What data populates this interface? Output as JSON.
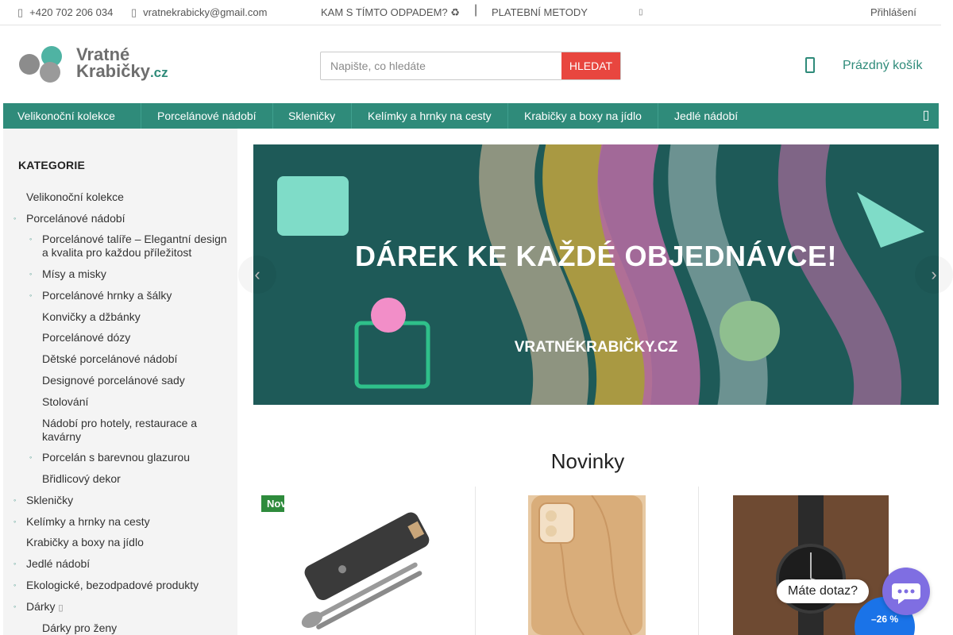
{
  "topbar": {
    "phone": "+420 702 206 034",
    "email": "vratnekrabicky@gmail.com",
    "link_waste": "KAM S TÍMTO ODPADEM? ♻",
    "separator": "|",
    "link_payment": "PLATEBNÍ METODY",
    "login": "Přihlášení"
  },
  "header": {
    "logo_line1": "Vratné",
    "logo_line2": "Krabičky",
    "logo_tld": ".cz",
    "search_placeholder": "Napište, co hledáte",
    "search_button": "HLEDAT",
    "cart_label": "Prázdný košík"
  },
  "nav": {
    "items": [
      "Velikonoční kolekce",
      "Porcelánové nádobí",
      "Skleničky",
      "Kelímky a hrnky na cesty",
      "Krabičky a boxy na jídlo",
      "Jedlé nádobí"
    ]
  },
  "sidebar": {
    "title": "KATEGORIE",
    "items": [
      "Velikonoční kolekce",
      "Porcelánové nádobí",
      "Porcelánové talíře – Elegantní design a kvalita pro každou příležitost",
      "Mísy a misky",
      "Porcelánové hrnky a šálky",
      "Konvičky a džbánky",
      "Porcelánové dózy",
      "Dětské porcelánové nádobí",
      "Designové porcelánové sady",
      "Stolování",
      "Nádobí pro hotely, restaurace a kavárny",
      "Porcelán s barevnou glazurou",
      "Břidlicový dekor",
      "Skleničky",
      "Kelímky a hrnky na cesty",
      "Krabičky a boxy na jídlo",
      "Jedlé nádobí",
      "Ekologické, bezodpadové produkty",
      "Dárky",
      "Dárky pro ženy"
    ]
  },
  "banner": {
    "title": "DÁREK KE KAŽDÉ OBJEDNÁVCE!",
    "url": "VRATNÉKRABIČKY.CZ"
  },
  "novinky": {
    "title": "Novinky",
    "badge": "Novinka",
    "discount": "–26 %"
  },
  "chat": {
    "label": "Máte dotaz?"
  },
  "colors": {
    "brand_green": "#2f8b7a",
    "search_red": "#e8463f",
    "badge_green": "#2e8b3c",
    "discount_blue": "#1a73e8",
    "chat_purple": "#7f6ee2"
  }
}
